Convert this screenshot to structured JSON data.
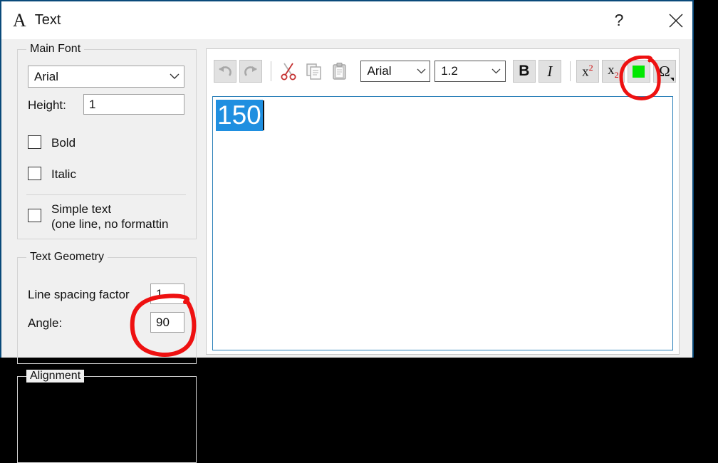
{
  "window": {
    "title": "Text",
    "title_icon": "letter-a-icon",
    "help_label": "?",
    "close_label": "close-icon"
  },
  "left_pane": {
    "main_font": {
      "group_label": "Main Font",
      "font_combo_value": "Arial",
      "height_label": "Height:",
      "height_value": "1",
      "bold_label": "Bold",
      "bold_checked": false,
      "italic_label": "Italic",
      "italic_checked": false,
      "simple_text_label_line1": "Simple text",
      "simple_text_label_line2": "(one line, no formattin",
      "simple_text_checked": false
    },
    "text_geometry": {
      "group_label": "Text Geometry",
      "line_spacing_label": "Line spacing factor",
      "line_spacing_value": "1",
      "angle_label": "Angle:",
      "angle_value": "90"
    },
    "alignment": {
      "group_label": "Alignment"
    }
  },
  "editor": {
    "toolbar": {
      "undo": "undo-icon",
      "redo": "redo-icon",
      "cut": "scissors-icon",
      "copy": "copy-icon",
      "paste": "paste-icon",
      "font_combo_value": "Arial",
      "size_combo_value": "1.2",
      "bold_label": "B",
      "italic_label": "I",
      "superscript_base": "x",
      "superscript_exp": "2",
      "subscript_base": "x",
      "subscript_exp": "2",
      "color_swatch": "#00e800",
      "omega_label": "Ω"
    },
    "content": {
      "selected_text": "150"
    }
  },
  "annotations": {
    "color": "#ee1111",
    "angle_circle": "red-circle-around-angle-field",
    "color_button_circle": "red-circle-around-color-button"
  }
}
